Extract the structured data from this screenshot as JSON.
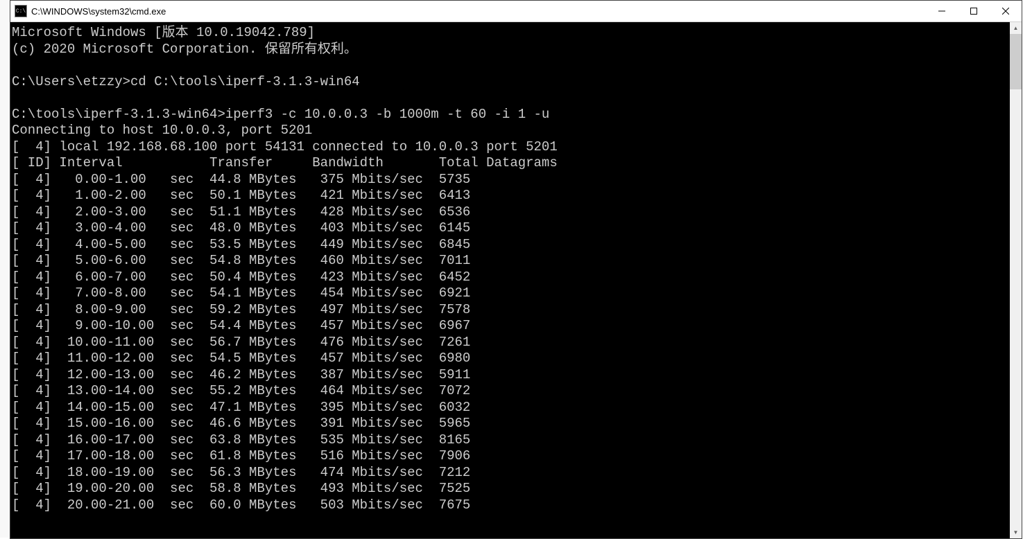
{
  "window": {
    "title": "C:\\WINDOWS\\system32\\cmd.exe"
  },
  "header": {
    "line1": "Microsoft Windows [版本 10.0.19042.789]",
    "line2": "(c) 2020 Microsoft Corporation. 保留所有权利。"
  },
  "prompts": {
    "p1": "C:\\Users\\etzzy>",
    "cmd1": "cd C:\\tools\\iperf-3.1.3-win64",
    "p2": "C:\\tools\\iperf-3.1.3-win64>",
    "cmd2": "iperf3 -c 10.0.0.3 -b 1000m -t 60 -i 1 -u"
  },
  "connect_line": "Connecting to host 10.0.0.3, port 5201",
  "local_line": "[  4] local 192.168.68.100 port 54131 connected to 10.0.0.3 port 5201",
  "header_line": "[ ID] Interval           Transfer     Bandwidth       Total Datagrams",
  "rows": [
    {
      "id": "4",
      "interval": " 0.00-1.00 ",
      "transfer": "44.8 MBytes",
      "bandwidth": " 375 Mbits/sec",
      "datagrams": "5735"
    },
    {
      "id": "4",
      "interval": " 1.00-2.00 ",
      "transfer": "50.1 MBytes",
      "bandwidth": " 421 Mbits/sec",
      "datagrams": "6413"
    },
    {
      "id": "4",
      "interval": " 2.00-3.00 ",
      "transfer": "51.1 MBytes",
      "bandwidth": " 428 Mbits/sec",
      "datagrams": "6536"
    },
    {
      "id": "4",
      "interval": " 3.00-4.00 ",
      "transfer": "48.0 MBytes",
      "bandwidth": " 403 Mbits/sec",
      "datagrams": "6145"
    },
    {
      "id": "4",
      "interval": " 4.00-5.00 ",
      "transfer": "53.5 MBytes",
      "bandwidth": " 449 Mbits/sec",
      "datagrams": "6845"
    },
    {
      "id": "4",
      "interval": " 5.00-6.00 ",
      "transfer": "54.8 MBytes",
      "bandwidth": " 460 Mbits/sec",
      "datagrams": "7011"
    },
    {
      "id": "4",
      "interval": " 6.00-7.00 ",
      "transfer": "50.4 MBytes",
      "bandwidth": " 423 Mbits/sec",
      "datagrams": "6452"
    },
    {
      "id": "4",
      "interval": " 7.00-8.00 ",
      "transfer": "54.1 MBytes",
      "bandwidth": " 454 Mbits/sec",
      "datagrams": "6921"
    },
    {
      "id": "4",
      "interval": " 8.00-9.00 ",
      "transfer": "59.2 MBytes",
      "bandwidth": " 497 Mbits/sec",
      "datagrams": "7578"
    },
    {
      "id": "4",
      "interval": " 9.00-10.00",
      "transfer": "54.4 MBytes",
      "bandwidth": " 457 Mbits/sec",
      "datagrams": "6967"
    },
    {
      "id": "4",
      "interval": "10.00-11.00",
      "transfer": "56.7 MBytes",
      "bandwidth": " 476 Mbits/sec",
      "datagrams": "7261"
    },
    {
      "id": "4",
      "interval": "11.00-12.00",
      "transfer": "54.5 MBytes",
      "bandwidth": " 457 Mbits/sec",
      "datagrams": "6980"
    },
    {
      "id": "4",
      "interval": "12.00-13.00",
      "transfer": "46.2 MBytes",
      "bandwidth": " 387 Mbits/sec",
      "datagrams": "5911"
    },
    {
      "id": "4",
      "interval": "13.00-14.00",
      "transfer": "55.2 MBytes",
      "bandwidth": " 464 Mbits/sec",
      "datagrams": "7072"
    },
    {
      "id": "4",
      "interval": "14.00-15.00",
      "transfer": "47.1 MBytes",
      "bandwidth": " 395 Mbits/sec",
      "datagrams": "6032"
    },
    {
      "id": "4",
      "interval": "15.00-16.00",
      "transfer": "46.6 MBytes",
      "bandwidth": " 391 Mbits/sec",
      "datagrams": "5965"
    },
    {
      "id": "4",
      "interval": "16.00-17.00",
      "transfer": "63.8 MBytes",
      "bandwidth": " 535 Mbits/sec",
      "datagrams": "8165"
    },
    {
      "id": "4",
      "interval": "17.00-18.00",
      "transfer": "61.8 MBytes",
      "bandwidth": " 516 Mbits/sec",
      "datagrams": "7906"
    },
    {
      "id": "4",
      "interval": "18.00-19.00",
      "transfer": "56.3 MBytes",
      "bandwidth": " 474 Mbits/sec",
      "datagrams": "7212"
    },
    {
      "id": "4",
      "interval": "19.00-20.00",
      "transfer": "58.8 MBytes",
      "bandwidth": " 493 Mbits/sec",
      "datagrams": "7525"
    },
    {
      "id": "4",
      "interval": "20.00-21.00",
      "transfer": "60.0 MBytes",
      "bandwidth": " 503 Mbits/sec",
      "datagrams": "7675"
    }
  ]
}
